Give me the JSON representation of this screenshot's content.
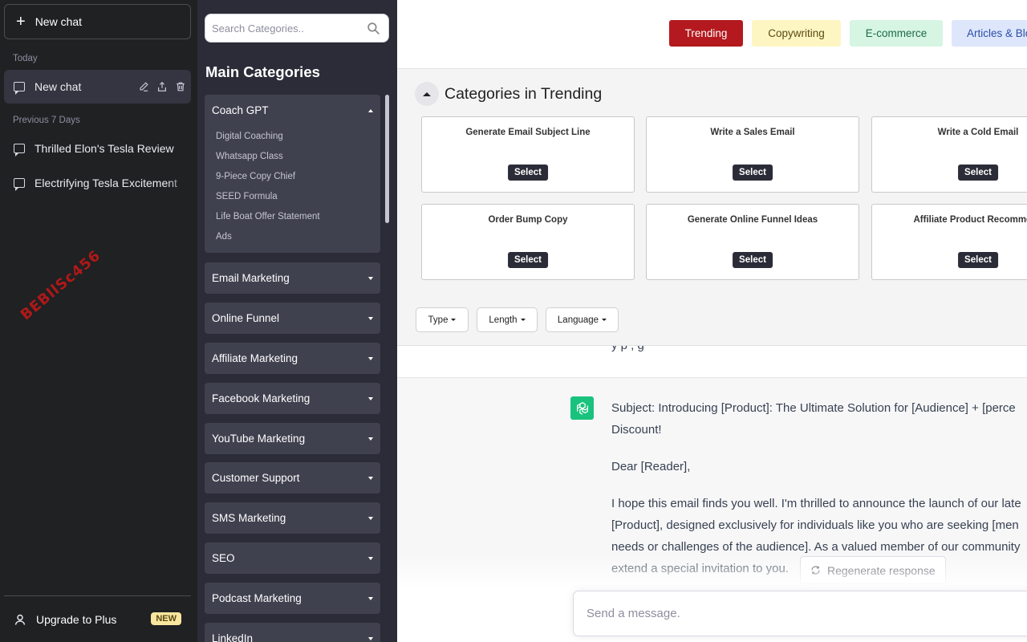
{
  "sidebar": {
    "new_chat_label": "New chat",
    "today_heading": "Today",
    "prev7_heading": "Previous 7 Days",
    "chats_today": [
      {
        "label": "New chat"
      }
    ],
    "chats_prev": [
      {
        "label": "Thrilled Elon's Tesla Review"
      },
      {
        "label": "Electrifying Tesla Excitement"
      }
    ],
    "watermark": "BEBllSc456",
    "upgrade_label": "Upgrade to Plus",
    "new_badge": "NEW"
  },
  "categories": {
    "search_placeholder": "Search Categories..",
    "main_title": "Main Categories",
    "expanded": {
      "label": "Coach GPT",
      "items": [
        "Digital Coaching",
        "Whatsapp Class",
        "9-Piece Copy Chief",
        "SEED Formula",
        "Life Boat Offer Statement",
        "Ads"
      ]
    },
    "collapsed": [
      "Email Marketing",
      "Online Funnel",
      "Affiliate Marketing",
      "Facebook Marketing",
      "YouTube Marketing",
      "Customer Support",
      "SMS Marketing",
      "SEO",
      "Podcast Marketing",
      "LinkedIn"
    ]
  },
  "main": {
    "tabs": [
      {
        "label": "Trending",
        "bg": "#b3191e",
        "fg": "#ffffff"
      },
      {
        "label": "Copywriting",
        "bg": "#fdf6c3",
        "fg": "#5a4a12"
      },
      {
        "label": "E-commerce",
        "bg": "#d6f5e3",
        "fg": "#1f6b45"
      },
      {
        "label": "Articles & Blo",
        "bg": "#dde6fb",
        "fg": "#2b4fa8"
      }
    ],
    "section_title": "Categories in Trending",
    "select_label": "Select",
    "cards": [
      "Generate Email Subject Line",
      "Write a Sales Email",
      "Write a Cold Email",
      "Order Bump Copy",
      "Generate Online Funnel Ideas",
      "Affiliate Product Recommend"
    ],
    "filters": [
      "Type",
      "Length",
      "Language"
    ],
    "partial_text": "y p , g",
    "response": {
      "subject": "Subject: Introducing [Product]: The Ultimate Solution for [Audience] + [perce",
      "subject_cont": "Discount!",
      "greeting": "Dear [Reader],",
      "body": [
        "I hope this email finds you well. I'm thrilled to announce the launch of our late",
        "[Product], designed exclusively for individuals like you who are seeking [men",
        "needs or challenges of the audience]. As a valued member of our community",
        "extend a special invitation to you."
      ]
    },
    "regenerate_label": "Regenerate response",
    "message_placeholder": "Send a message."
  }
}
